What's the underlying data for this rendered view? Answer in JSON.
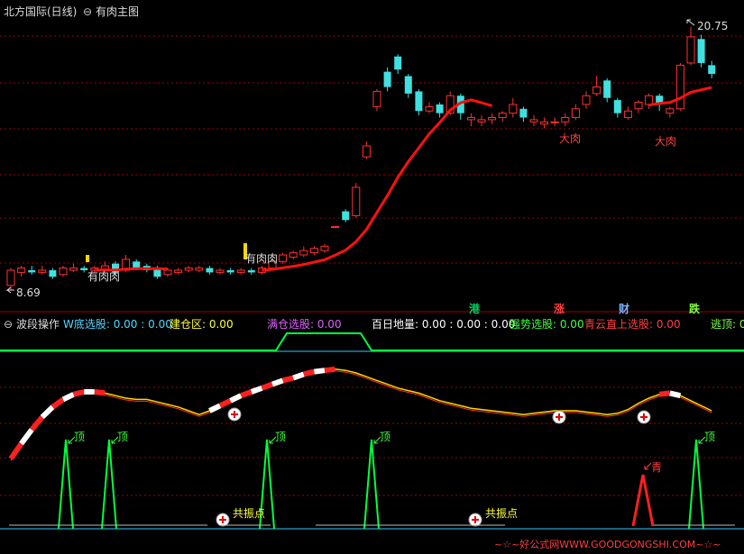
{
  "top_panel": {
    "stock_name": "北方国际(日线)",
    "indicator": "有肉主图",
    "high_label": "20.75",
    "low_label": "8.69",
    "annotations": [
      "有肉肉",
      "有肉肉",
      "大肉",
      "大肉"
    ],
    "tags": [
      {
        "text": "港",
        "color": "#00d060"
      },
      {
        "text": "涨",
        "color": "#ff4040"
      },
      {
        "text": "财",
        "color": "#7fb0ff"
      },
      {
        "text": "跌",
        "color": "#80ff40"
      }
    ]
  },
  "bottom_panel": {
    "items": [
      {
        "text": "波段操作",
        "color": "#dddddd"
      },
      {
        "text": "W底选股: 0.00 : 0.00",
        "color": "#55d5ff"
      },
      {
        "text": "建仓区: 0.00",
        "color": "#ffff40"
      },
      {
        "text": "满仓选股: 0.00",
        "color": "#e060ff"
      },
      {
        "text": "百日地量: 0.00 : 0.00 : 0.00",
        "color": "#ffffff"
      },
      {
        "text": "强势选股: 0.00",
        "color": "#40ff40"
      },
      {
        "text": "青云直上选股: 0.00",
        "color": "#ff4040"
      },
      {
        "text": "逃顶: 0.",
        "color": "#80ff40"
      }
    ],
    "top_label": "顶",
    "qing_label": "青",
    "resonance_label": "共振点",
    "watermark": "~☆~好公式网WWW.GOODGONGSHI.COM~☆~"
  },
  "colors": {
    "grid": "#a00000",
    "up": "#ff3030",
    "down": "#40e0e0",
    "ma": "#ff1010",
    "green": "#00ff40",
    "yellow": "#ffd700"
  },
  "chart_data": [
    {
      "type": "candlestick",
      "x_count": 68,
      "ylim": [
        8.69,
        20.75
      ],
      "candles": [
        [
          8.9,
          9.6,
          9.7,
          8.69
        ],
        [
          9.5,
          9.7,
          9.8,
          9.3
        ],
        [
          9.6,
          9.5,
          9.8,
          9.4
        ],
        [
          9.5,
          9.6,
          9.8,
          9.4
        ],
        [
          9.6,
          9.3,
          9.7,
          9.2
        ],
        [
          9.4,
          9.7,
          9.8,
          9.3
        ],
        [
          9.6,
          9.7,
          9.9,
          9.5
        ],
        [
          9.7,
          9.6,
          9.8,
          9.5
        ],
        [
          9.6,
          9.7,
          9.8,
          9.5
        ],
        [
          9.6,
          9.8,
          10.0,
          9.5
        ],
        [
          9.9,
          9.5,
          10.0,
          9.4
        ],
        [
          9.6,
          10.1,
          10.3,
          9.5
        ],
        [
          10.0,
          9.7,
          10.1,
          9.6
        ],
        [
          9.8,
          9.6,
          9.9,
          9.5
        ],
        [
          9.7,
          9.3,
          9.8,
          9.2
        ],
        [
          9.4,
          9.6,
          9.7,
          9.3
        ],
        [
          9.5,
          9.6,
          9.7,
          9.4
        ],
        [
          9.6,
          9.7,
          9.8,
          9.5
        ],
        [
          9.6,
          9.7,
          9.8,
          9.5
        ],
        [
          9.7,
          9.5,
          9.8,
          9.4
        ],
        [
          9.5,
          9.6,
          9.7,
          9.4
        ],
        [
          9.6,
          9.5,
          9.7,
          9.4
        ],
        [
          9.5,
          9.6,
          9.7,
          9.4
        ],
        [
          9.6,
          9.5,
          9.7,
          9.4
        ],
        [
          9.5,
          9.7,
          9.8,
          9.4
        ],
        [
          9.7,
          10.0,
          10.1,
          9.6
        ],
        [
          10.0,
          10.3,
          10.4,
          9.9
        ],
        [
          10.2,
          10.4,
          10.5,
          10.1
        ],
        [
          10.3,
          10.5,
          10.7,
          10.2
        ],
        [
          10.4,
          10.6,
          10.7,
          10.3
        ],
        [
          10.5,
          10.7,
          10.8,
          10.4
        ],
        [
          11.6,
          11.6,
          11.6,
          11.6
        ],
        [
          12.3,
          11.9,
          12.4,
          11.8
        ],
        [
          12.1,
          13.4,
          13.6,
          12.0
        ],
        [
          14.8,
          15.3,
          15.5,
          14.7
        ],
        [
          17.1,
          17.8,
          17.9,
          16.9
        ],
        [
          18.7,
          18.0,
          18.9,
          17.8
        ],
        [
          19.4,
          18.8,
          19.5,
          18.6
        ],
        [
          18.5,
          17.7,
          18.6,
          17.5
        ],
        [
          17.8,
          16.9,
          17.9,
          16.7
        ],
        [
          16.9,
          17.1,
          17.3,
          16.8
        ],
        [
          17.2,
          16.8,
          17.3,
          16.6
        ],
        [
          16.8,
          17.6,
          17.8,
          16.7
        ],
        [
          17.6,
          16.8,
          17.7,
          16.5
        ],
        [
          16.5,
          16.6,
          16.8,
          16.2
        ],
        [
          16.4,
          16.5,
          16.7,
          16.2
        ],
        [
          16.5,
          16.6,
          16.8,
          16.3
        ],
        [
          16.6,
          16.8,
          16.9,
          16.4
        ],
        [
          16.8,
          17.2,
          17.5,
          16.6
        ],
        [
          17.0,
          16.6,
          17.1,
          16.4
        ],
        [
          16.4,
          16.5,
          16.7,
          16.2
        ],
        [
          16.3,
          16.4,
          16.6,
          16.1
        ],
        [
          16.4,
          16.4,
          16.6,
          16.2
        ],
        [
          16.4,
          16.6,
          16.8,
          16.2
        ],
        [
          16.6,
          17.0,
          17.2,
          16.5
        ],
        [
          17.2,
          17.6,
          17.8,
          17.0
        ],
        [
          17.7,
          18.0,
          18.5,
          17.6
        ],
        [
          18.3,
          17.5,
          18.4,
          17.3
        ],
        [
          17.4,
          16.8,
          17.5,
          16.6
        ],
        [
          16.6,
          16.9,
          17.1,
          16.5
        ],
        [
          17.0,
          17.3,
          17.4,
          16.8
        ],
        [
          17.2,
          17.6,
          17.7,
          17.0
        ],
        [
          17.6,
          17.2,
          17.7,
          16.9
        ],
        [
          16.8,
          17.0,
          17.1,
          16.6
        ],
        [
          17.0,
          19.0,
          19.1,
          16.9
        ],
        [
          19.1,
          20.3,
          20.75,
          19.0
        ],
        [
          20.2,
          19.1,
          20.4,
          18.9
        ],
        [
          19.0,
          18.6,
          19.2,
          18.4
        ]
      ]
    },
    {
      "type": "line",
      "name": "波段操作",
      "x_count": 68,
      "values": [
        0.22,
        0.34,
        0.45,
        0.55,
        0.63,
        0.69,
        0.73,
        0.75,
        0.75,
        0.74,
        0.72,
        0.7,
        0.69,
        0.69,
        0.67,
        0.65,
        0.63,
        0.6,
        0.57,
        0.6,
        0.64,
        0.68,
        0.72,
        0.75,
        0.78,
        0.81,
        0.84,
        0.86,
        0.89,
        0.91,
        0.92,
        0.93,
        0.92,
        0.9,
        0.87,
        0.84,
        0.81,
        0.78,
        0.76,
        0.74,
        0.71,
        0.68,
        0.66,
        0.64,
        0.62,
        0.61,
        0.6,
        0.59,
        0.58,
        0.57,
        0.58,
        0.59,
        0.6,
        0.6,
        0.6,
        0.59,
        0.58,
        0.57,
        0.58,
        0.61,
        0.66,
        0.7,
        0.73,
        0.74,
        0.72,
        0.68,
        0.64,
        0.6
      ],
      "ylim": [
        0,
        1
      ]
    }
  ]
}
